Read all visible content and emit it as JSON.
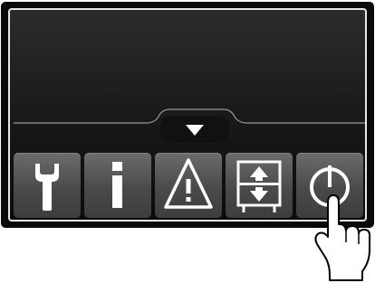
{
  "display": {
    "expand_button": {
      "icon": "chevron-down-icon"
    }
  },
  "toolbar": {
    "buttons": [
      {
        "id": "service",
        "icon": "wrench-icon"
      },
      {
        "id": "info",
        "icon": "info-icon"
      },
      {
        "id": "warning",
        "icon": "warning-triangle-icon"
      },
      {
        "id": "transfer",
        "icon": "up-down-transfer-icon"
      },
      {
        "id": "power",
        "icon": "power-icon",
        "state": "being-pressed"
      }
    ]
  },
  "colors": {
    "frame": "#0a0a0a",
    "screen_border": "#e6e6e6",
    "button_face": "#4a4a4a",
    "icon": "#ffffff"
  }
}
